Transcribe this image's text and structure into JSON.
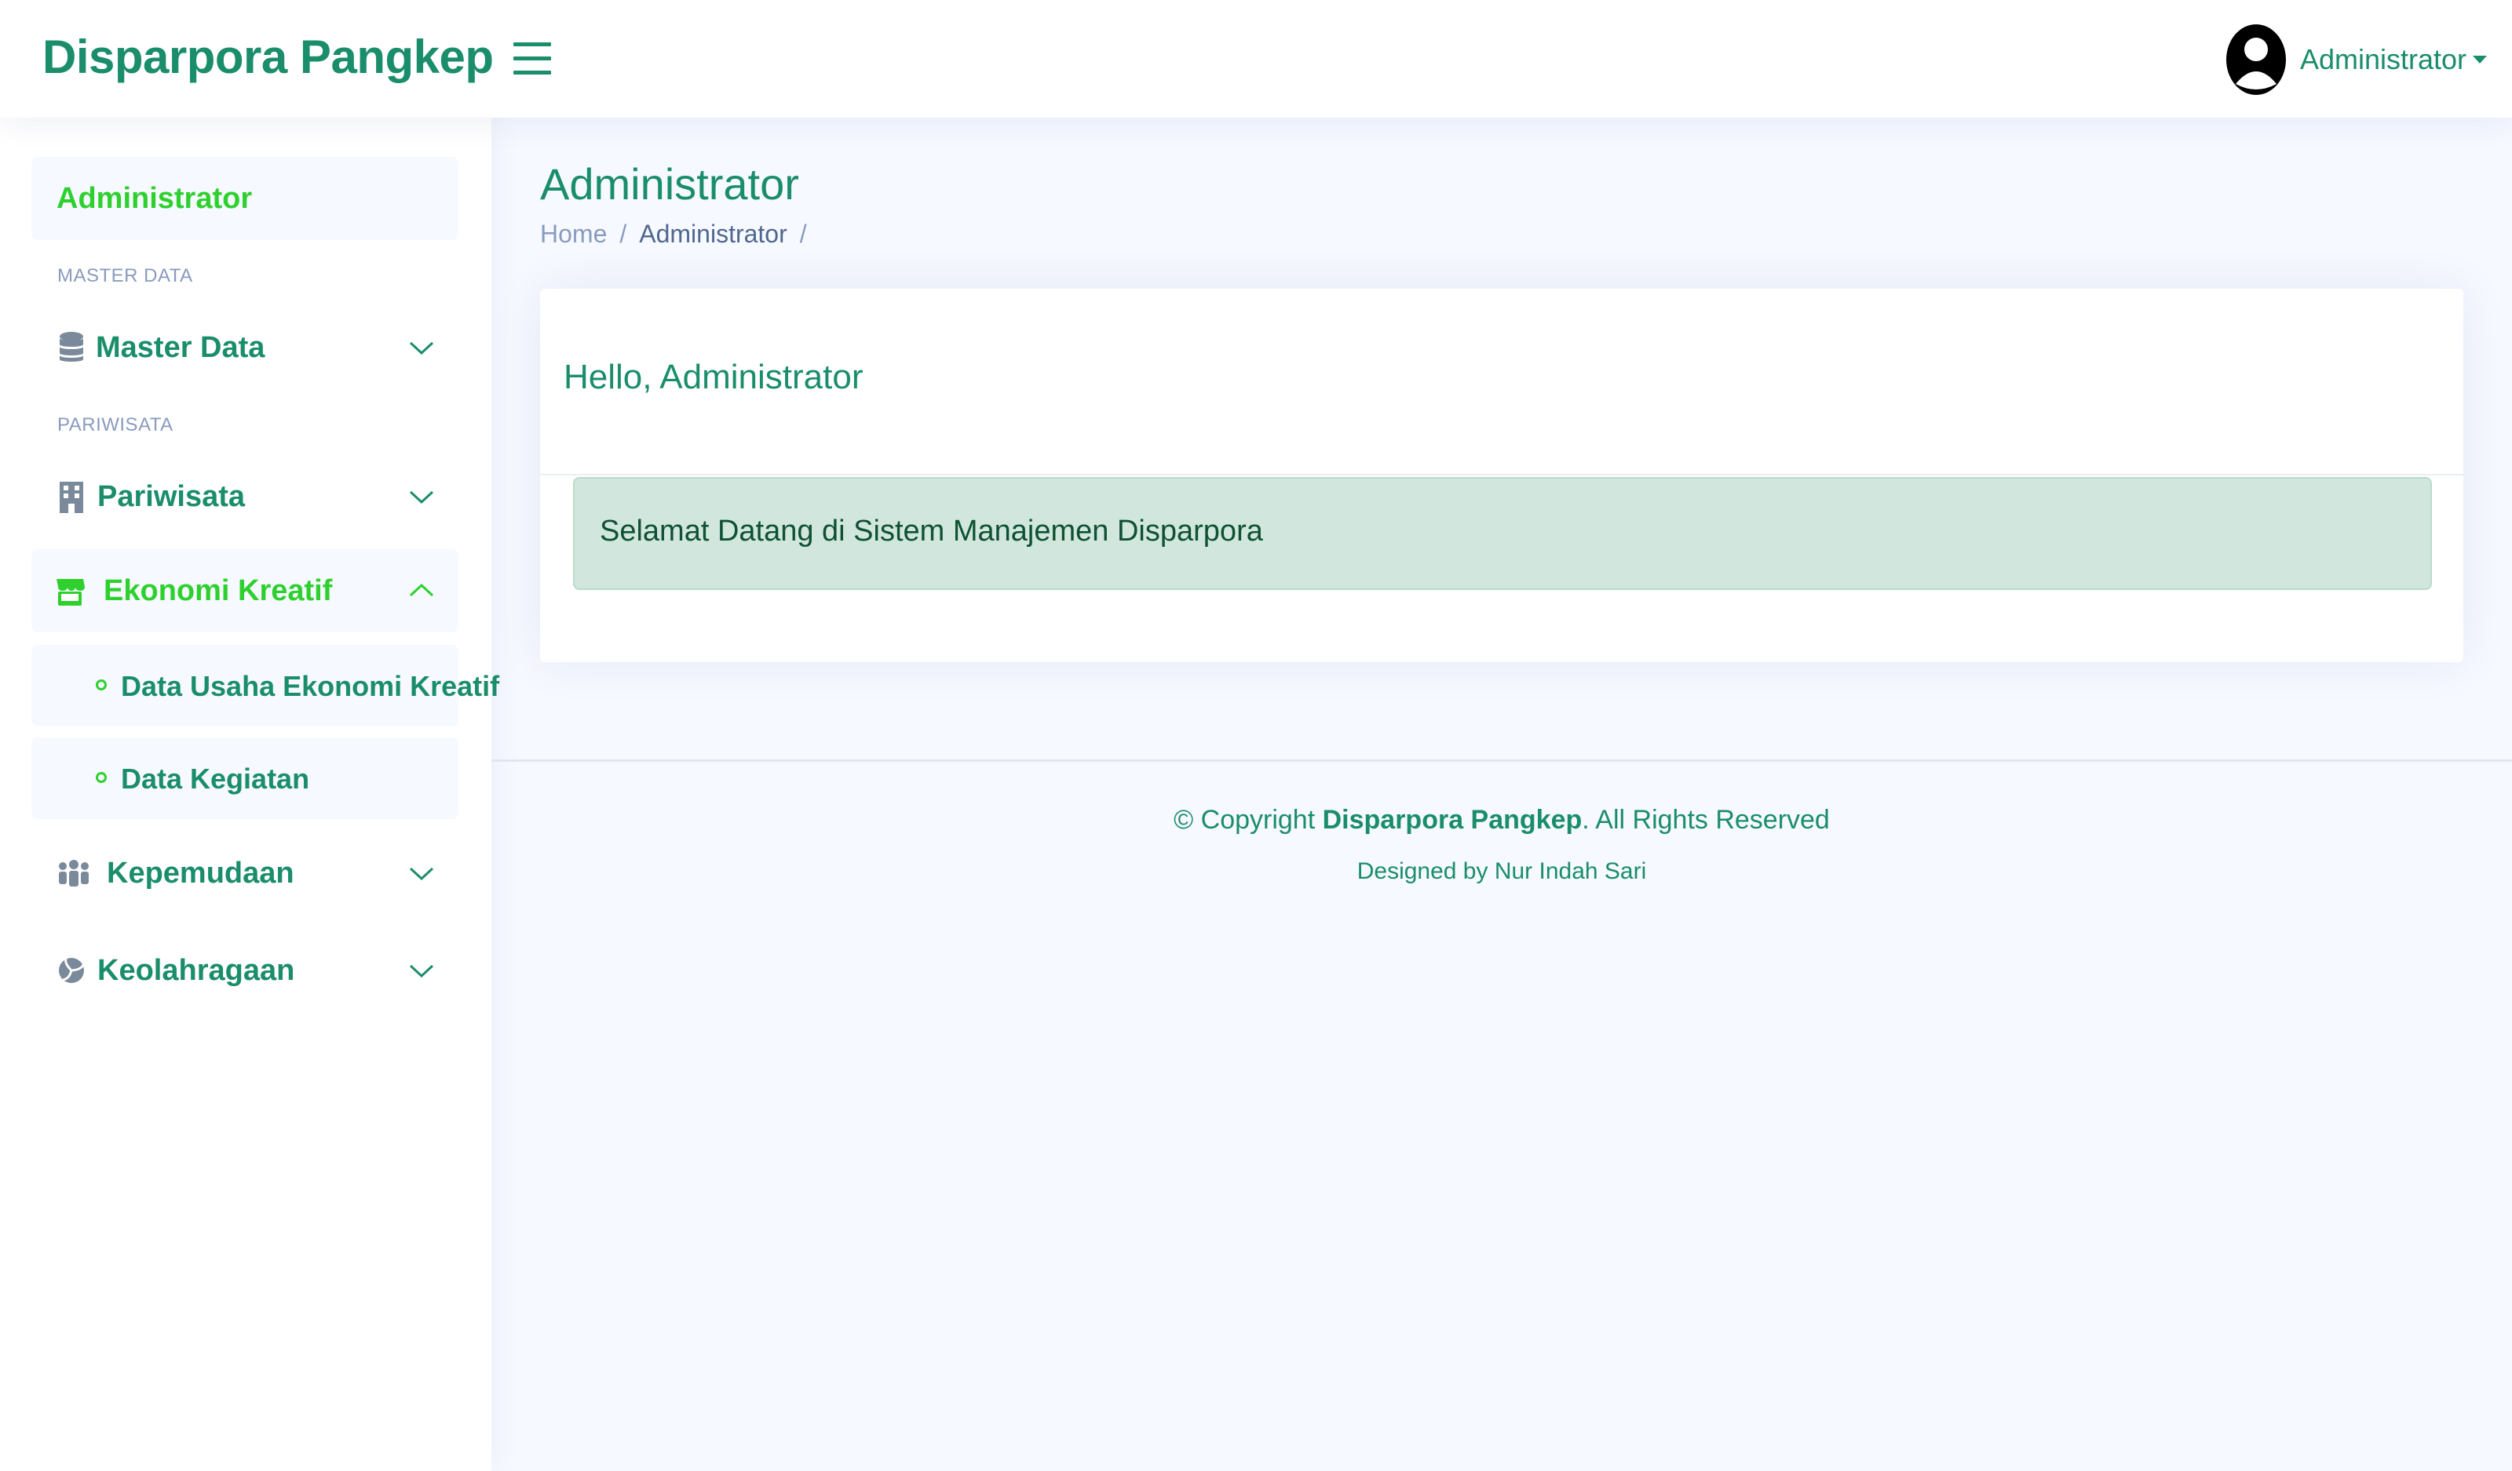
{
  "header": {
    "logo": "Disparpora Pangkep",
    "profile_name": "Administrator"
  },
  "sidebar": {
    "top_item": "Administrator",
    "sections": [
      {
        "heading": "MASTER DATA"
      },
      {
        "heading": "PARIWISATA"
      }
    ],
    "items": [
      {
        "label": "Master Data",
        "icon": "database-icon",
        "expanded": false
      },
      {
        "label": "Pariwisata",
        "icon": "building-icon",
        "expanded": false
      },
      {
        "label": "Ekonomi Kreatif",
        "icon": "shop-icon",
        "expanded": true
      },
      {
        "label": "Kepemudaan",
        "icon": "people-icon",
        "expanded": false
      },
      {
        "label": "Keolahragaan",
        "icon": "volleyball-icon",
        "expanded": false
      }
    ],
    "subitems": [
      {
        "label": "Data Usaha Ekonomi Kreatif"
      },
      {
        "label": "Data Kegiatan"
      }
    ]
  },
  "main": {
    "page_title": "Administrator",
    "breadcrumb": [
      "Home",
      "Administrator"
    ],
    "card_title": "Hello, Administrator",
    "alert_text": "Selamat Datang di Sistem Manajemen Disparpora"
  },
  "footer": {
    "copy_prefix": "© Copyright ",
    "brand": "Disparpora Pangkep",
    "copy_suffix": ". All Rights Reserved",
    "credit": "Designed by Nur Indah Sari"
  },
  "colors": {
    "brand": "#1a8d6b",
    "active": "#2ed02e",
    "muted": "#899bbd",
    "alert_bg": "#d1e7dd",
    "page_bg": "#f6f9ff"
  }
}
